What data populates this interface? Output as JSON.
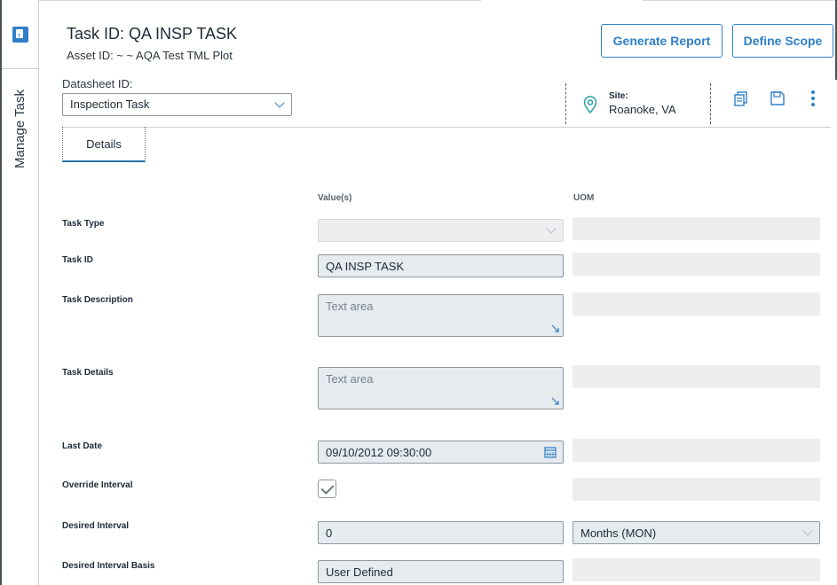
{
  "rail": {
    "label": "Manage Task",
    "toggle_icon": "panel-expand-icon"
  },
  "header": {
    "title": "Task ID: QA INSP TASK",
    "subtitle": "Asset ID: ~ ~ AQA Test TML Plot",
    "generate_report": "Generate Report",
    "define_scope": "Define Scope"
  },
  "datasheet": {
    "label": "Datasheet ID:",
    "value": "Inspection Task"
  },
  "site": {
    "label": "Site:",
    "value": "Roanoke, VA",
    "icon": "location-pin-icon"
  },
  "toolbar": {
    "icons": [
      "copy-icon",
      "save-icon",
      "more-vert-icon"
    ]
  },
  "tabs": [
    {
      "label": "Details",
      "active": true
    }
  ],
  "columns": {
    "values": "Value(s)",
    "uom": "UOM"
  },
  "fields": {
    "task_type": {
      "label": "Task Type",
      "value": ""
    },
    "task_id": {
      "label": "Task ID",
      "value": "QA INSP TASK"
    },
    "task_description": {
      "label": "Task Description",
      "placeholder": "Text area"
    },
    "task_details": {
      "label": "Task Details",
      "placeholder": "Text area"
    },
    "last_date": {
      "label": "Last Date",
      "value": "09/10/2012 09:30:00"
    },
    "override_interval": {
      "label": "Override Interval",
      "checked": true
    },
    "desired_interval": {
      "label": "Desired Interval",
      "value": "0",
      "uom": "Months (MON)"
    },
    "desired_interval_basis": {
      "label": "Desired Interval Basis",
      "value": "User Defined"
    }
  },
  "colors": {
    "accent": "#2f7fc8",
    "field_bg": "#e6ebf0",
    "tab_underline": "#1f6fa6"
  }
}
